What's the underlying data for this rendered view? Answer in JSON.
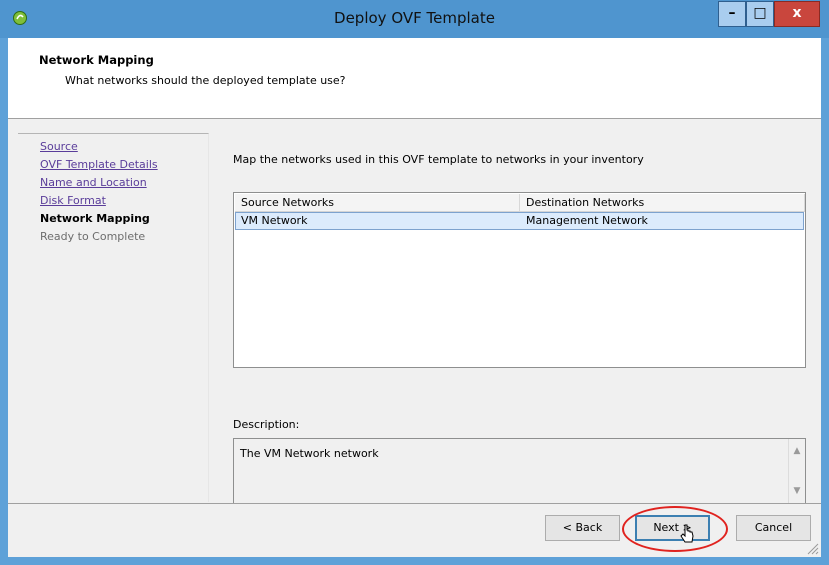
{
  "window": {
    "title": "Deploy OVF Template",
    "minimize_symbol": "–",
    "maximize_symbol": "□",
    "close_symbol": "x",
    "app_icon": "vsphere-icon"
  },
  "header": {
    "title": "Network Mapping",
    "subtitle": "What networks should the deployed template use?"
  },
  "nav": {
    "items": [
      {
        "label": "Source",
        "state": "visited"
      },
      {
        "label": "OVF Template Details",
        "state": "visited"
      },
      {
        "label": "Name and Location",
        "state": "visited"
      },
      {
        "label": "Disk Format",
        "state": "visited"
      },
      {
        "label": "Network Mapping",
        "state": "current"
      },
      {
        "label": "Ready to Complete",
        "state": "pending"
      }
    ]
  },
  "main": {
    "instruction": "Map the networks used in this OVF template to networks in your inventory",
    "table": {
      "columns": [
        "Source Networks",
        "Destination Networks"
      ],
      "rows": [
        {
          "source": "VM Network",
          "destination": "Management Network",
          "selected": true
        }
      ]
    },
    "description_label": "Description:",
    "description_text": "The VM Network network"
  },
  "footer": {
    "back_label": "< Back",
    "next_label": "Next >",
    "cancel_label": "Cancel"
  },
  "colors": {
    "titlebar": "#4f95cf",
    "close_button": "#c9463d",
    "link": "#5a3d9a",
    "selected_row": "#dcebfc",
    "annotation": "#e0231f"
  }
}
